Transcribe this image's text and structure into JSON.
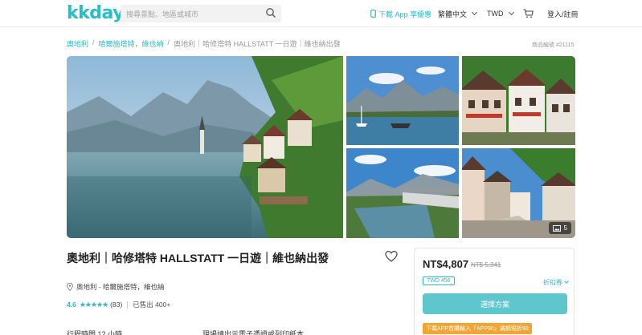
{
  "header": {
    "logo": "kkday",
    "search_placeholder": "搜尋景點、地區或城市",
    "app_promo": "下載 App 享優惠",
    "language": "繁體中文",
    "currency": "TWD",
    "login": "登入/註冊"
  },
  "breadcrumb": {
    "items": [
      "奧地利",
      "哈爾施塔特，維也納",
      "奧地利｜哈修塔特 HALLSTATT 一日遊｜維也納出發"
    ],
    "separator": "/"
  },
  "product_number": "商品編號 #21115",
  "gallery": {
    "photo_count": "5"
  },
  "product": {
    "title": "奧地利｜哈修塔特 HALLSTATT 一日遊｜維也納出發",
    "location": "奧地利 - 哈爾施塔特，維也納",
    "rating_score": "4.6",
    "stars": "★★★★★",
    "review_count": "(83)",
    "sold": "已售出 400+",
    "duration": "行程時間 12 小時",
    "voucher": "現場請出示電子憑證或列印紙本"
  },
  "booking": {
    "price": "NT$4,807",
    "original_price": "NT$ 5,341",
    "tag": "TWD 456",
    "discount": "折扣券",
    "select_button": "選擇方案",
    "promo": "下載APP首購輸入「APP90」滿額現折90"
  },
  "colors": {
    "brand": "#26bec9",
    "button": "#5ec7cd",
    "promo": "#f2a531"
  }
}
